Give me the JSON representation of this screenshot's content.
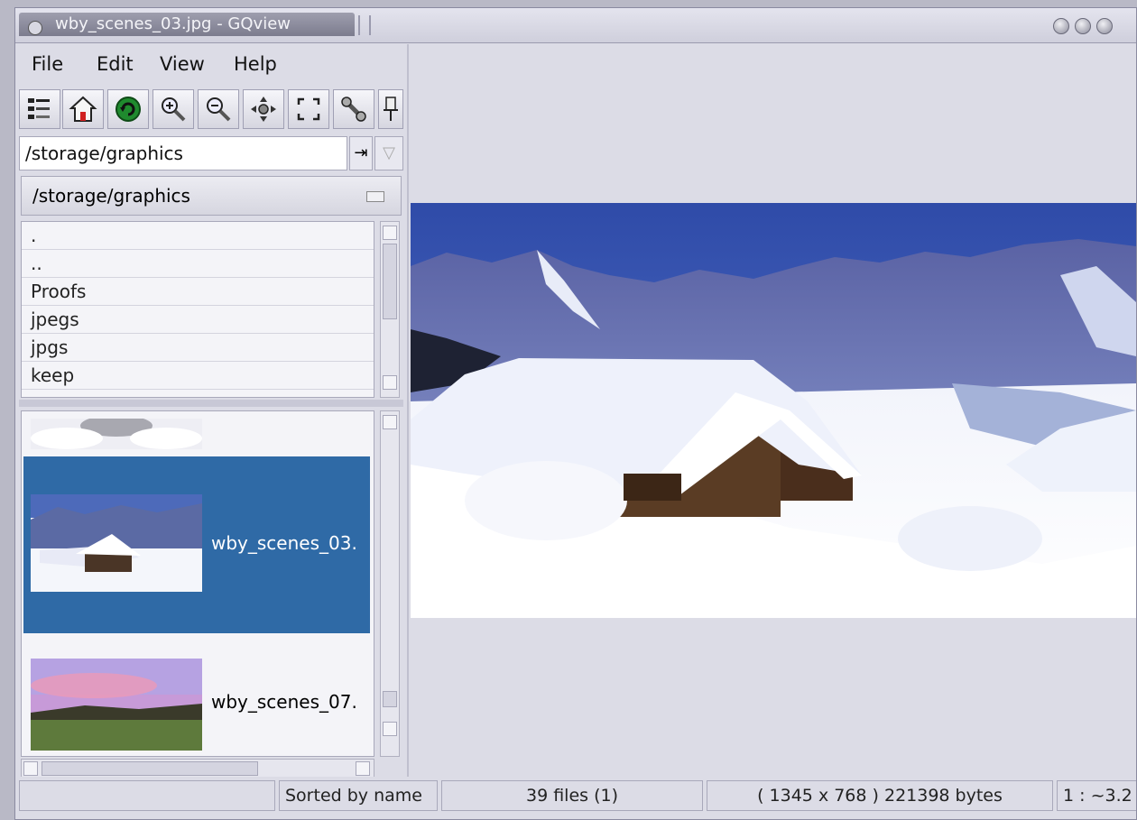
{
  "window": {
    "title": "wby_scenes_03.jpg - GQview"
  },
  "menu": {
    "file": "File",
    "edit": "Edit",
    "view": "View",
    "help": "Help"
  },
  "toolbar": {
    "buttons": [
      "thumbnails-toggle-icon",
      "home-icon",
      "refresh-icon",
      "zoom-in-icon",
      "zoom-out-icon",
      "zoom-fit-icon",
      "fullscreen-icon",
      "config-icon",
      "float-icon"
    ]
  },
  "path": {
    "value": "/storage/graphics",
    "go_glyph": "⇥",
    "drop_glyph": "▽"
  },
  "dir_header": {
    "label": "/storage/graphics"
  },
  "dir_list": {
    "items": [
      ".",
      "..",
      "Proofs",
      "jpegs",
      "jpgs",
      "keep"
    ]
  },
  "thumbnails": [
    {
      "name": ""
    },
    {
      "name": "wby_scenes_03."
    },
    {
      "name": "wby_scenes_07."
    }
  ],
  "status": {
    "sort": "Sorted by name",
    "count": "39 files (1)",
    "info": "( 1345 x 768 ) 221398 bytes",
    "zoom": "1 : ~3.2"
  },
  "colors": {
    "selection": "#2f6aa6",
    "background": "#dcdce6"
  }
}
